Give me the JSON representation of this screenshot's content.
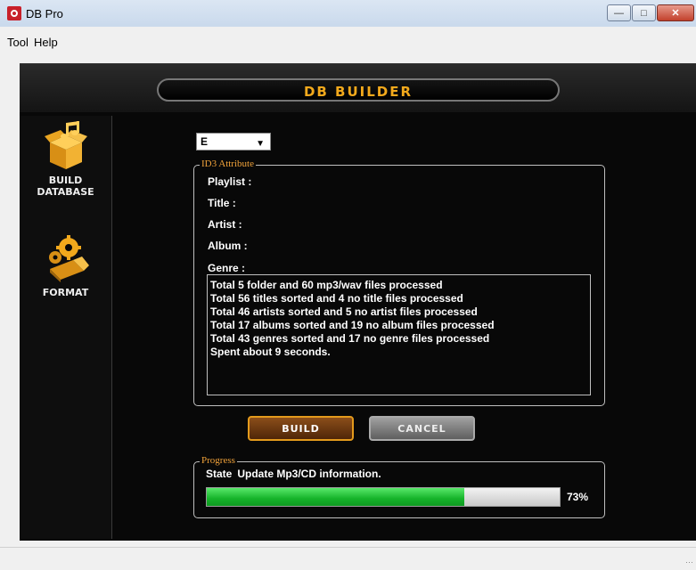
{
  "window": {
    "title": "DB Pro"
  },
  "menu": {
    "items": [
      "Tool",
      "Help"
    ]
  },
  "header": {
    "title": "DB BUILDER"
  },
  "sidebar": {
    "build_label_1": "BUILD",
    "build_label_2": "DATABASE",
    "format_label": "FORMAT",
    "icons": [
      "box-music-icon",
      "gear-usb-icon"
    ]
  },
  "drive": {
    "value": "E"
  },
  "id3": {
    "legend": "ID3 Attribute",
    "playlist": "Playlist :",
    "title": "Title :",
    "artist": "Artist :",
    "album": "Album :",
    "genre": "Genre :"
  },
  "log": [
    "Total 5 folder and 60 mp3/wav files processed",
    "Total 56 titles sorted and 4 no title files processed",
    "Total 46 artists sorted and 5 no artist files processed",
    "Total 17 albums sorted and 19 no album files processed",
    "Total 43 genres sorted and 17 no genre files processed",
    "Spent about 9 seconds."
  ],
  "buttons": {
    "build": "BUILD",
    "cancel": "CANCEL"
  },
  "progress": {
    "legend": "Progress",
    "state_label": "State",
    "state_value": "Update Mp3/CD information.",
    "percent_text": "73%",
    "fraction": 0.73
  },
  "colors": {
    "accent": "#f2a91c",
    "progress": "#1fc43a",
    "background": "#080808"
  }
}
